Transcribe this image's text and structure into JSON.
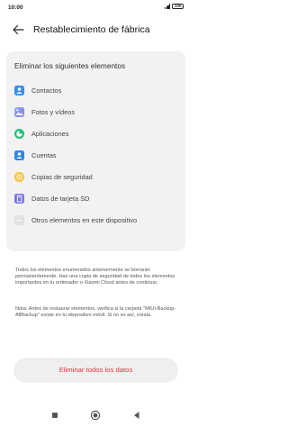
{
  "status_bar": {
    "time": "10:00",
    "battery": "100"
  },
  "header": {
    "title": "Restablecimiento de fábrica"
  },
  "card": {
    "title": "Eliminar los siguientes elementos",
    "items": [
      {
        "label": "Contactos",
        "icon": "contacts-icon",
        "color": "#3b8fe6"
      },
      {
        "label": "Fotos y vídeos",
        "icon": "photos-icon",
        "color": "#7c8ef0"
      },
      {
        "label": "Aplicaciones",
        "icon": "apps-icon",
        "color": "#21c07a"
      },
      {
        "label": "Cuentas",
        "icon": "accounts-icon",
        "color": "#2f86e8"
      },
      {
        "label": "Copias de seguridad",
        "icon": "backup-icon",
        "color": "#f5c23a"
      },
      {
        "label": "Datos de tarjeta SD",
        "icon": "sd-card-icon",
        "color": "#7b74e8"
      },
      {
        "label": "Otros elementos en este dispositivo",
        "icon": "other-items-icon",
        "color": "#e2e2e2"
      }
    ]
  },
  "description": {
    "p1": "Todos los elementos enumerados anteriormente se borrarán permanentemente. Haz una copia de seguridad de todos los elementos importantes en tu ordenador o Xiaomi Cloud antes de continuar.",
    "p2": "Nota: Antes de restaurar elementos, verifica si la carpeta \"MIUI-Backup-AllBackup\" existe en tu dispositivo móvil. Si no es así, créala."
  },
  "action": {
    "label": "Eliminar todos los datos",
    "color": "#e0343c"
  }
}
